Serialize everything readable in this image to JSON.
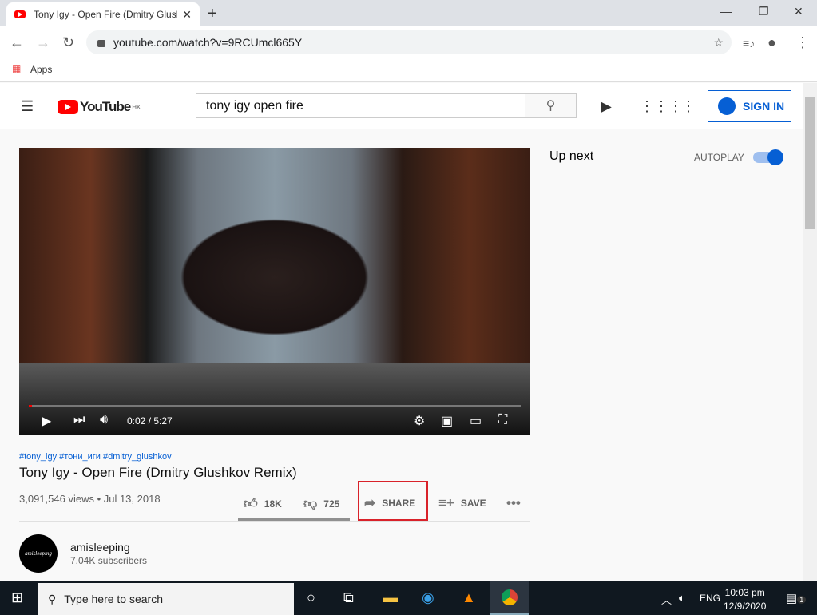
{
  "browser": {
    "tab_title": "Tony Igy - Open Fire (Dmitry Glushkov Remix) - YouTube",
    "url": "youtube.com/watch?v=9RCUmcl665Y",
    "bookmark": "Apps"
  },
  "header": {
    "logo": "YouTube",
    "region": "HK",
    "search_value": "tony igy open fire",
    "sign_in": "SIGN IN"
  },
  "player": {
    "time": "0:02 / 5:27",
    "progress_fraction": 0.006
  },
  "video": {
    "tags": "#tony_igy #тони_иги #dmitry_glushkov",
    "title": "Tony Igy - Open Fire (Dmitry Glushkov Remix)",
    "views_date": "3,091,546 views • Jul 13, 2018",
    "likes": "18K",
    "dislikes": "725",
    "share": "SHARE",
    "save": "SAVE"
  },
  "channel": {
    "name": "amisleeping",
    "subscribers": "7.04K subscribers",
    "avatar_text": "amisleeping"
  },
  "sidebar": {
    "up_next": "Up next",
    "autoplay": "AUTOPLAY",
    "autoplay_on": true
  },
  "taskbar": {
    "search_placeholder": "Type here to search",
    "lang": "ENG",
    "time": "10:03 pm",
    "date": "12/9/2020",
    "notifications": "1"
  },
  "colors": {
    "accent": "#065fd4",
    "highlight": "#d9222a",
    "brand": "#ff0000"
  }
}
